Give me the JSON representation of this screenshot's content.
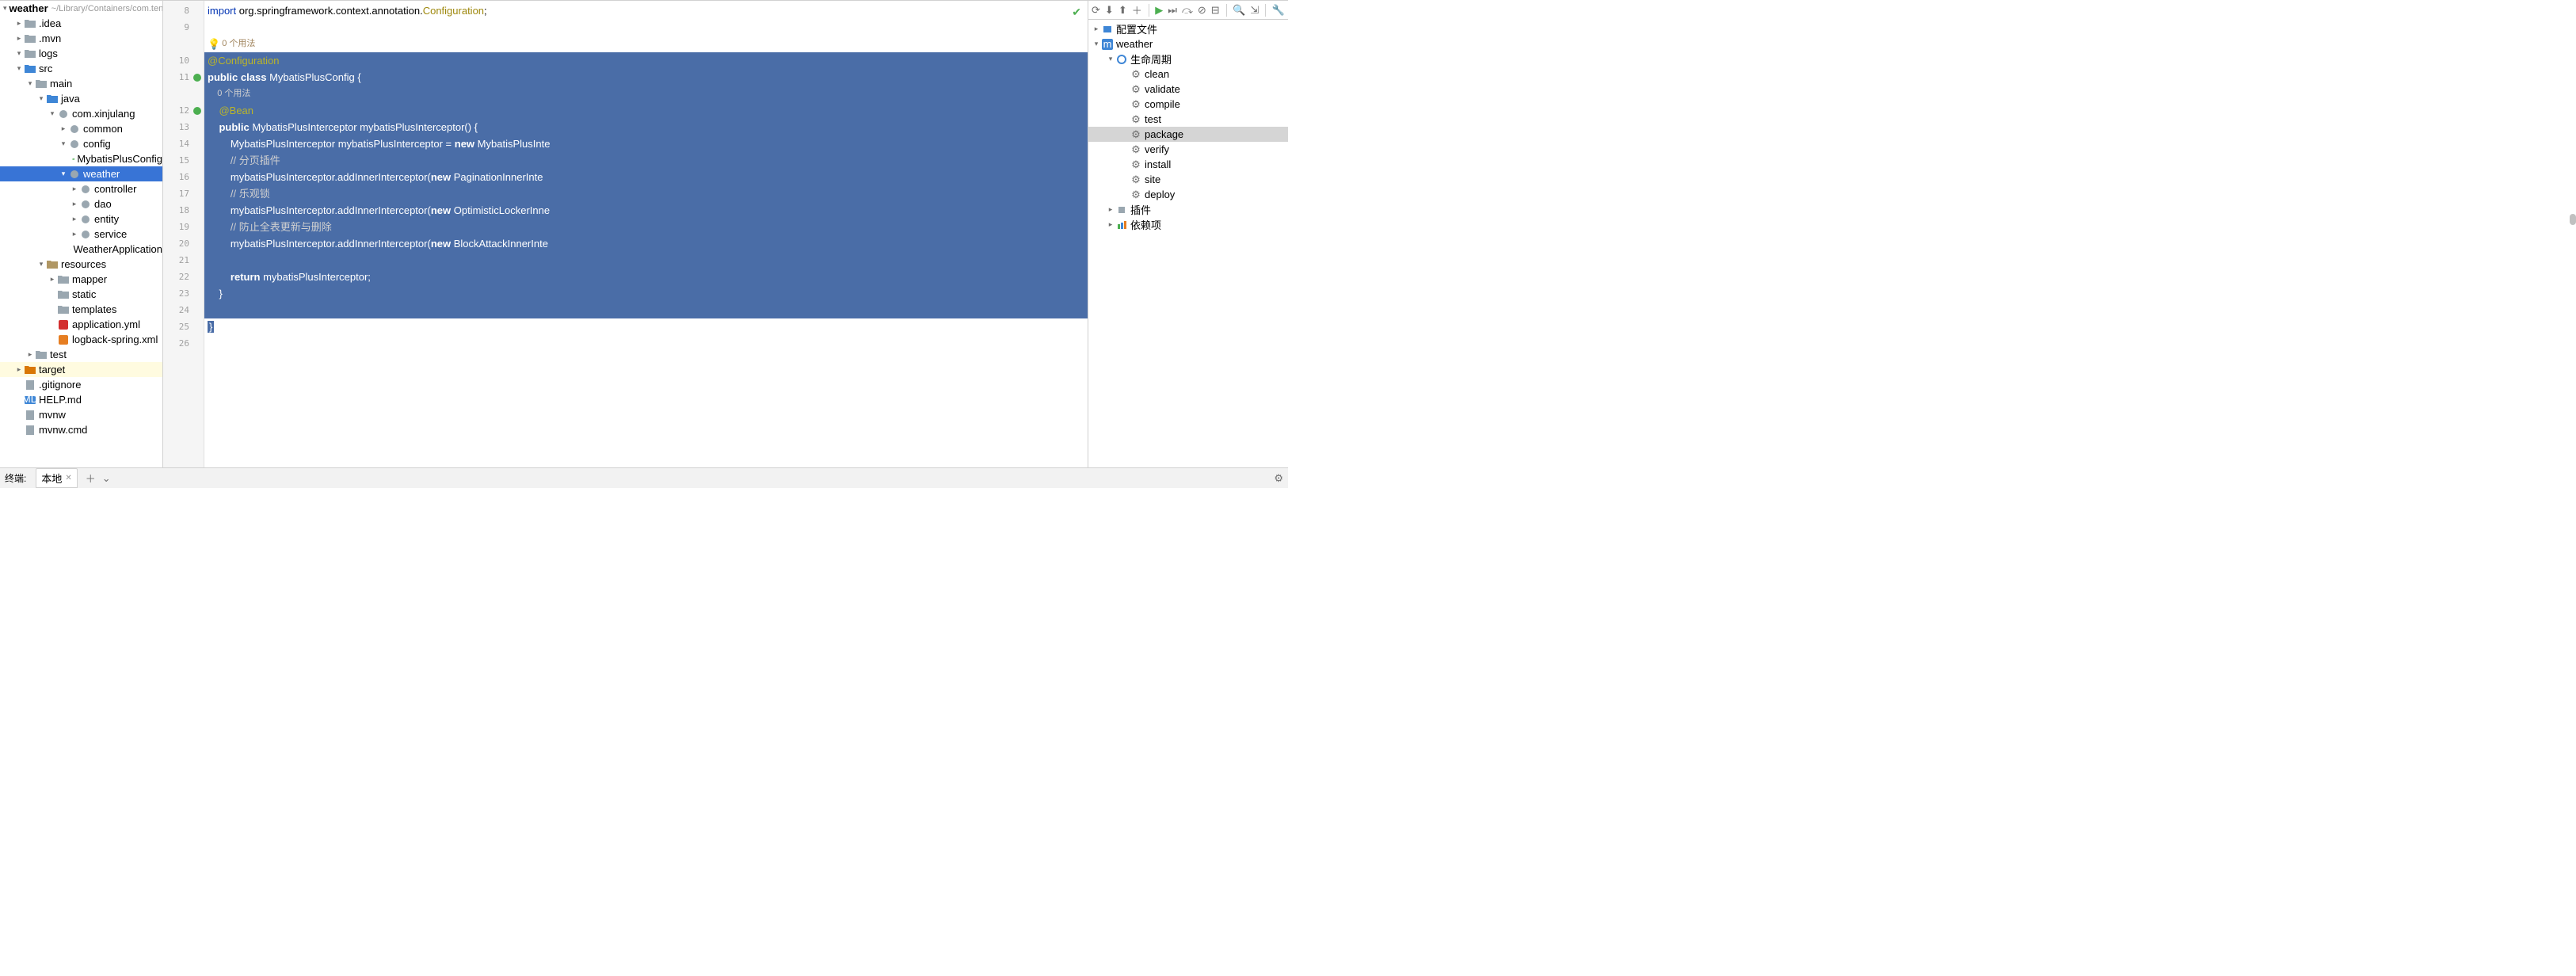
{
  "project": {
    "root_name": "weather",
    "root_path": "~/Library/Containers/com.tencent.xinWeChat/Data/Li",
    "tree": [
      {
        "indent": 1,
        "arrow": ">",
        "icon": "folder",
        "label": ".idea"
      },
      {
        "indent": 1,
        "arrow": ">",
        "icon": "folder",
        "label": ".mvn"
      },
      {
        "indent": 1,
        "arrow": "v",
        "icon": "folder",
        "label": "logs"
      },
      {
        "indent": 1,
        "arrow": "v",
        "icon": "folder-src",
        "label": "src"
      },
      {
        "indent": 2,
        "arrow": "v",
        "icon": "folder",
        "label": "main"
      },
      {
        "indent": 3,
        "arrow": "v",
        "icon": "folder-src",
        "label": "java"
      },
      {
        "indent": 4,
        "arrow": "v",
        "icon": "package",
        "label": "com.xinjulang"
      },
      {
        "indent": 5,
        "arrow": ">",
        "icon": "package",
        "label": "common"
      },
      {
        "indent": 5,
        "arrow": "v",
        "icon": "package",
        "label": "config"
      },
      {
        "indent": 6,
        "arrow": "",
        "icon": "class",
        "label": "MybatisPlusConfig"
      },
      {
        "indent": 5,
        "arrow": "v",
        "icon": "package",
        "label": "weather",
        "selected": true
      },
      {
        "indent": 6,
        "arrow": ">",
        "icon": "package",
        "label": "controller"
      },
      {
        "indent": 6,
        "arrow": ">",
        "icon": "package",
        "label": "dao"
      },
      {
        "indent": 6,
        "arrow": ">",
        "icon": "package",
        "label": "entity"
      },
      {
        "indent": 6,
        "arrow": ">",
        "icon": "package",
        "label": "service"
      },
      {
        "indent": 6,
        "arrow": "",
        "icon": "class",
        "label": "WeatherApplication"
      },
      {
        "indent": 3,
        "arrow": "v",
        "icon": "folder-res",
        "label": "resources"
      },
      {
        "indent": 4,
        "arrow": ">",
        "icon": "folder",
        "label": "mapper"
      },
      {
        "indent": 4,
        "arrow": "",
        "icon": "folder",
        "label": "static"
      },
      {
        "indent": 4,
        "arrow": "",
        "icon": "folder",
        "label": "templates"
      },
      {
        "indent": 4,
        "arrow": "",
        "icon": "yml",
        "label": "application.yml"
      },
      {
        "indent": 4,
        "arrow": "",
        "icon": "xml",
        "label": "logback-spring.xml"
      },
      {
        "indent": 2,
        "arrow": ">",
        "icon": "folder",
        "label": "test"
      },
      {
        "indent": 1,
        "arrow": ">",
        "icon": "folder-exc",
        "label": "target",
        "highlighted": true
      },
      {
        "indent": 1,
        "arrow": "",
        "icon": "gitignore",
        "label": ".gitignore"
      },
      {
        "indent": 1,
        "arrow": "",
        "icon": "md",
        "label": "HELP.md"
      },
      {
        "indent": 1,
        "arrow": "",
        "icon": "sh",
        "label": "mvnw"
      },
      {
        "indent": 1,
        "arrow": "",
        "icon": "cmd",
        "label": "mvnw.cmd"
      }
    ]
  },
  "editor": {
    "lines": [
      {
        "n": 8,
        "type": "code",
        "html": "<span class='kw'>import</span> org.springframework.context.annotation.<span class='ann'>Configuration</span>;"
      },
      {
        "n": 9,
        "type": "code",
        "html": ""
      },
      {
        "n": "",
        "type": "hint",
        "text": "0 个用法",
        "bulb": true
      },
      {
        "n": 10,
        "type": "sel",
        "html": "<span class='ann'>@Configuration</span>"
      },
      {
        "n": 11,
        "type": "sel",
        "html": "<span class='kw'>public</span> <span class='kw'>class</span> MybatisPlusConfig {",
        "mark": "green"
      },
      {
        "n": "",
        "type": "sel-hint",
        "text": "    0 个用法"
      },
      {
        "n": 12,
        "type": "sel",
        "html": "    <span class='ann'>@Bean</span>",
        "mark": "green"
      },
      {
        "n": 13,
        "type": "sel",
        "html": "    <span class='kw'>public</span> MybatisPlusInterceptor mybatisPlusInterceptor() {"
      },
      {
        "n": 14,
        "type": "sel",
        "html": "        MybatisPlusInterceptor mybatisPlusInterceptor = <span class='kw'>new</span> MybatisPlusInte"
      },
      {
        "n": 15,
        "type": "sel",
        "html": "        <span class='com'>// 分页插件</span>"
      },
      {
        "n": 16,
        "type": "sel",
        "html": "        mybatisPlusInterceptor.addInnerInterceptor(<span class='kw'>new</span> PaginationInnerInte"
      },
      {
        "n": 17,
        "type": "sel",
        "html": "        <span class='com'>// 乐观锁</span>"
      },
      {
        "n": 18,
        "type": "sel",
        "html": "        mybatisPlusInterceptor.addInnerInterceptor(<span class='kw'>new</span> OptimisticLockerInne"
      },
      {
        "n": 19,
        "type": "sel",
        "html": "        <span class='com'>// 防止全表更新与删除</span>"
      },
      {
        "n": 20,
        "type": "sel",
        "html": "        mybatisPlusInterceptor.addInnerInterceptor(<span class='kw'>new</span> BlockAttackInnerInte"
      },
      {
        "n": 21,
        "type": "sel",
        "html": ""
      },
      {
        "n": 22,
        "type": "sel",
        "html": "        <span class='kw'>return</span> mybatisPlusInterceptor;"
      },
      {
        "n": 23,
        "type": "sel",
        "html": "    }"
      },
      {
        "n": 24,
        "type": "sel",
        "html": ""
      },
      {
        "n": 25,
        "type": "sel-end",
        "html": "}"
      },
      {
        "n": 26,
        "type": "code",
        "html": ""
      }
    ]
  },
  "maven": {
    "toolbar_icons": [
      "refresh",
      "download",
      "upload",
      "add",
      "sep",
      "run",
      "step",
      "skip",
      "offline",
      "stop",
      "sep",
      "find",
      "expand",
      "sep",
      "settings"
    ],
    "tree": [
      {
        "indent": 0,
        "arrow": ">",
        "icon": "profiles",
        "label": "配置文件"
      },
      {
        "indent": 0,
        "arrow": "v",
        "icon": "m",
        "label": "weather"
      },
      {
        "indent": 1,
        "arrow": "v",
        "icon": "lifecycle",
        "label": "生命周期"
      },
      {
        "indent": 2,
        "arrow": "",
        "icon": "gear",
        "label": "clean"
      },
      {
        "indent": 2,
        "arrow": "",
        "icon": "gear",
        "label": "validate"
      },
      {
        "indent": 2,
        "arrow": "",
        "icon": "gear",
        "label": "compile"
      },
      {
        "indent": 2,
        "arrow": "",
        "icon": "gear",
        "label": "test"
      },
      {
        "indent": 2,
        "arrow": "",
        "icon": "gear",
        "label": "package",
        "selected": true
      },
      {
        "indent": 2,
        "arrow": "",
        "icon": "gear",
        "label": "verify"
      },
      {
        "indent": 2,
        "arrow": "",
        "icon": "gear",
        "label": "install"
      },
      {
        "indent": 2,
        "arrow": "",
        "icon": "gear",
        "label": "site"
      },
      {
        "indent": 2,
        "arrow": "",
        "icon": "gear",
        "label": "deploy"
      },
      {
        "indent": 1,
        "arrow": ">",
        "icon": "plugins",
        "label": "插件"
      },
      {
        "indent": 1,
        "arrow": ">",
        "icon": "deps",
        "label": "依赖项"
      }
    ]
  },
  "terminal": {
    "label": "终端:",
    "tab": "本地"
  }
}
